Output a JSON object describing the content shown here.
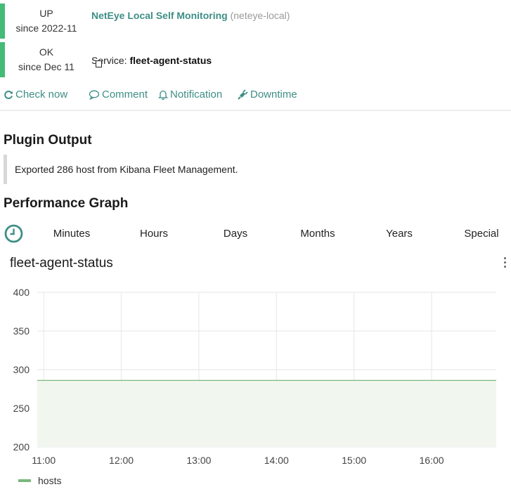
{
  "host_status": {
    "state": "UP",
    "since": "since 2022-11",
    "color": "#44bb77"
  },
  "host": {
    "name": "NetEye Local Self Monitoring",
    "id": "(neteye-local)"
  },
  "service_status": {
    "state": "OK",
    "since": "since Dec 11",
    "color": "#44bb77"
  },
  "service": {
    "prefix": "Service:",
    "name": "fleet-agent-status"
  },
  "actions": {
    "check_now": "Check now",
    "comment": "Comment",
    "notification": "Notification",
    "downtime": "Downtime",
    "color": "#3e8e86"
  },
  "plugin_output": {
    "title": "Plugin Output",
    "text": "Exported 286 host from Kibana Fleet Management."
  },
  "performance": {
    "title": "Performance Graph",
    "ranges": [
      "Minutes",
      "Hours",
      "Days",
      "Months",
      "Years",
      "Special"
    ]
  },
  "chart_data": {
    "type": "area",
    "title": "fleet-agent-status",
    "x_ticks": [
      "11:00",
      "12:00",
      "13:00",
      "14:00",
      "15:00",
      "16:00"
    ],
    "y_ticks": [
      200,
      250,
      300,
      350,
      400
    ],
    "ylim": [
      200,
      400
    ],
    "xlim": [
      "10:55",
      "16:50"
    ],
    "grid": true,
    "legend_position": "bottom-left",
    "series": [
      {
        "name": "hosts",
        "color": "#7ab87d",
        "fill": "#f1f6ef",
        "x": [
          "10:55",
          "16:50"
        ],
        "values": [
          286,
          286
        ]
      }
    ]
  }
}
